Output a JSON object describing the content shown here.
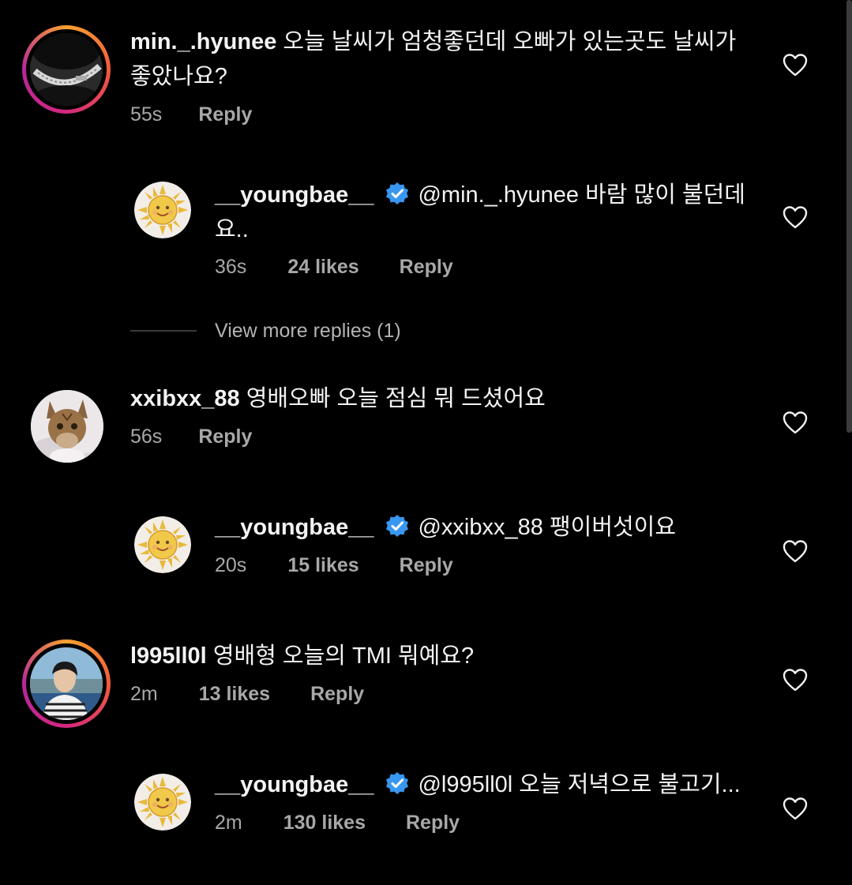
{
  "comments": [
    {
      "username": "min._.hyunee",
      "text": "오늘 날씨가 엄청좋던데 오빠가 있는곳도 날씨가 좋았나요?",
      "time": "55s",
      "reply_label": "Reply",
      "avatar_icon": "zipper-photo-avatar",
      "reply": {
        "username": "__youngbae__",
        "mention": "@min._.hyunee",
        "text": "바람 많이 불던데 요..",
        "time": "36s",
        "likes": "24 likes",
        "reply_label": "Reply",
        "avatar_icon": "sun-avatar"
      },
      "view_more": "View more replies (1)"
    },
    {
      "username": "xxibxx_88",
      "text": "영배오빠 오늘 점심 뭐 드셨어요",
      "time": "56s",
      "reply_label": "Reply",
      "avatar_icon": "cat-photo-avatar",
      "reply": {
        "username": "__youngbae__",
        "mention": "@xxibxx_88",
        "text": "팽이버섯이요",
        "time": "20s",
        "likes": "15 likes",
        "reply_label": "Reply",
        "avatar_icon": "sun-avatar"
      }
    },
    {
      "username": "l995ll0l",
      "text": "영배형 오늘의 TMI 뭐예요?",
      "time": "2m",
      "likes": "13 likes",
      "reply_label": "Reply",
      "avatar_icon": "person-photo-avatar",
      "reply": {
        "username": "__youngbae__",
        "mention": "@l995ll0l",
        "text": "오늘 저녁으로 불고기...",
        "time": "2m",
        "likes": "130 likes",
        "reply_label": "Reply",
        "avatar_icon": "sun-avatar"
      }
    }
  ],
  "colors": {
    "background": "#000000",
    "verified_badge": "#3897f0",
    "meta_text": "#a8a8a8"
  },
  "icons": [
    "heart-icon",
    "verified-badge-icon"
  ]
}
